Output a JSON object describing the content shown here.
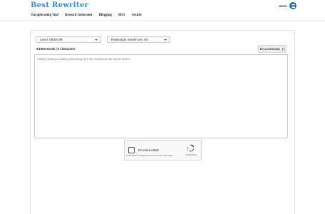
{
  "header": {
    "logo": "Best Rewriter",
    "menu_label": "MENU"
  },
  "nav": {
    "items": [
      "Paraphrasing Tool",
      "Reword Generator",
      "Blogging",
      "SEO",
      "Article"
    ]
  },
  "tool": {
    "level_select": "Level: MEDIUM",
    "sentences_select": "Rearrange Sentences: No",
    "counter": "0/1000 words | 0 characters",
    "keyword_button": "Keyword Density",
    "editor_placeholder": "Start by writing or pasting something here and then press the rewrite button."
  },
  "captcha": {
    "label": "I'm not a robot",
    "notice": "reCAPTCHA is changing its terms of service. Take action.",
    "brand": "reCAPTCHA"
  }
}
